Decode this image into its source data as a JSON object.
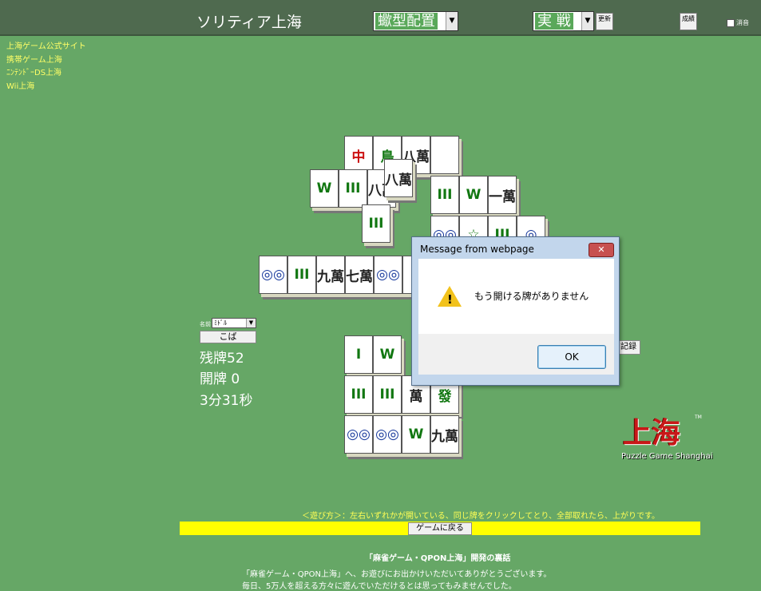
{
  "header": {
    "title": "ソリティア上海",
    "layout_select": "蠍型配置",
    "mode_select": "実 戦",
    "refresh_label": "更新",
    "results_label": "成績",
    "mute_label": "消音"
  },
  "links": [
    "上海ゲーム公式サイト",
    "携帯ゲーム上海",
    "ﾆﾝﾃﾝﾄﾞｰDS上海",
    "Wii上海"
  ],
  "tiles": [
    {
      "g": "中",
      "c": "red"
    },
    {
      "g": "鳥",
      "c": "green"
    },
    {
      "g": "八萬",
      "c": "black"
    },
    {
      "g": "",
      "c": "blank"
    },
    {
      "g": "W",
      "c": "green"
    },
    {
      "g": "III",
      "c": "green"
    },
    {
      "g": "八萬",
      "c": "black"
    },
    {
      "g": "III",
      "c": "green"
    },
    {
      "g": "W",
      "c": "green"
    },
    {
      "g": "一萬",
      "c": "black"
    },
    {
      "g": "III",
      "c": "green"
    },
    {
      "g": "◎◎",
      "c": "blue"
    },
    {
      "g": "☆",
      "c": "green"
    },
    {
      "g": "III",
      "c": "green"
    },
    {
      "g": "◎",
      "c": "blue"
    },
    {
      "g": "◎◎",
      "c": "blue"
    },
    {
      "g": "III",
      "c": "green"
    },
    {
      "g": "九萬",
      "c": "black"
    },
    {
      "g": "七萬",
      "c": "black"
    },
    {
      "g": "◎◎",
      "c": "blue"
    },
    {
      "g": "◎",
      "c": "blue"
    },
    {
      "g": "I",
      "c": "green"
    },
    {
      "g": "W",
      "c": "green"
    },
    {
      "g": "III",
      "c": "green"
    },
    {
      "g": "III",
      "c": "green"
    },
    {
      "g": "萬",
      "c": "black"
    },
    {
      "g": "發",
      "c": "green"
    },
    {
      "g": "◎◎",
      "c": "blue"
    },
    {
      "g": "◎◎",
      "c": "blue"
    },
    {
      "g": "W",
      "c": "green"
    },
    {
      "g": "九萬",
      "c": "black"
    }
  ],
  "dialog": {
    "title": "Message from webpage",
    "close": "✕",
    "message": "もう開ける牌がありません",
    "warn_icon": "!",
    "ok": "OK"
  },
  "player": {
    "name_label": "名前",
    "name_value": "ﾐﾄﾞﾙ",
    "name_button": "こば"
  },
  "stats": {
    "remaining": "残牌52",
    "open": "開牌 0",
    "time": "3分31秒"
  },
  "record_button": "記録",
  "logo": {
    "kanji": "上海",
    "tm": "TM",
    "sub": "Puzzle Game Shanghai"
  },
  "howto": "＜遊び方＞：左右いずれかが開いている、同じ牌をクリックしてとり、全部取れたら、上がりです。",
  "back_button": "ゲームに戻る",
  "story": {
    "title": "「麻雀ゲーム・QPON上海」開発の裏話",
    "line1": "「麻雀ゲーム・QPON上海」へ、お遊びにお出かけいただいてありがとうございます。",
    "line2": "毎日、5万人を超える方々に遊んでいただけるとは思ってもみませんでした。"
  },
  "colors": {
    "background": "#66a766",
    "topbar": "#4f6a4f",
    "link": "#ffff66",
    "yellow_bar": "#ffff00"
  }
}
